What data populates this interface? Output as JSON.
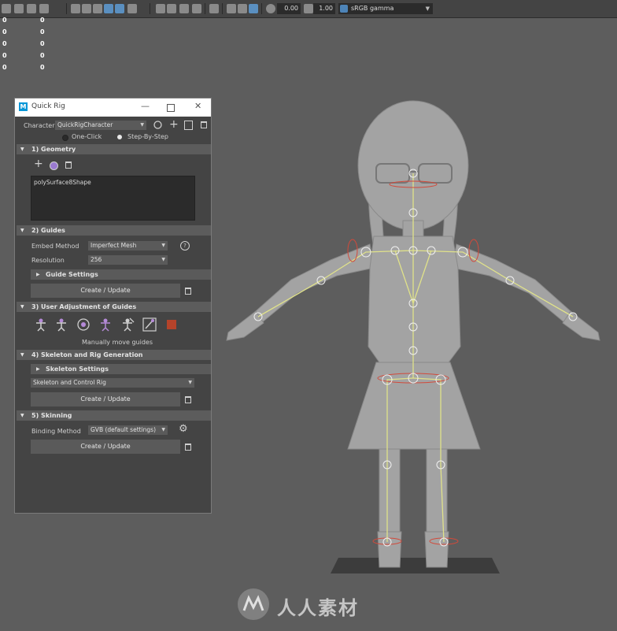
{
  "toolbar": {
    "exposure_value": "0.00",
    "gamma_value": "1.00",
    "color_space": "sRGB gamma",
    "icons": [
      "grid-icon",
      "camera-icon",
      "cube-icon",
      "shaded-icon",
      "wireframe-icon",
      "xray-icon",
      "light-icon",
      "isolate-icon",
      "sphere-icon",
      "texture-icon",
      "shadow-icon",
      "motion-blur-icon",
      "resolution-gate-icon",
      "film-gate-icon",
      "safe-action-icon",
      "exposure-icon",
      "gamma-icon",
      "color-management-icon"
    ]
  },
  "hud": {
    "rows": [
      {
        "left": "0",
        "right": "0"
      },
      {
        "left": "0",
        "right": "0"
      },
      {
        "left": "0",
        "right": "0"
      },
      {
        "left": "0",
        "right": "0"
      },
      {
        "left": "0",
        "right": "0"
      }
    ]
  },
  "quick_rig": {
    "title": "Quick Rig",
    "logo_letter": "M",
    "character_label": "Character:",
    "character_value": "QuickRigCharacter",
    "mode_one_click": "One-Click",
    "mode_step_by_step": "Step-By-Step",
    "selected_mode": "Step-By-Step",
    "sections": {
      "geometry": {
        "header": "1) Geometry",
        "items": [
          "polySurface8Shape"
        ]
      },
      "guides": {
        "header": "2) Guides",
        "embed_label": "Embed Method",
        "embed_value": "Imperfect Mesh",
        "resolution_label": "Resolution",
        "resolution_value": "256",
        "guide_settings": "Guide Settings",
        "create_update": "Create / Update"
      },
      "user_adjust": {
        "header": "3) User Adjustment of Guides",
        "caption": "Manually move guides"
      },
      "skeleton": {
        "header": "4) Skeleton and Rig Generation",
        "skeleton_settings": "Skeleton Settings",
        "rig_type": "Skeleton and Control Rig",
        "create_update": "Create / Update"
      },
      "skinning": {
        "header": "5) Skinning",
        "binding_label": "Binding Method",
        "binding_value": "GVB (default settings)",
        "create_update": "Create / Update"
      }
    }
  },
  "watermark": {
    "text": "人人素材"
  },
  "colors": {
    "viewport_bg": "#5d5d5d",
    "panel_bg": "#444444",
    "accent_blue": "#0696d7",
    "swatch_red": "#b5432a",
    "guide_purple": "#b58ad8"
  }
}
